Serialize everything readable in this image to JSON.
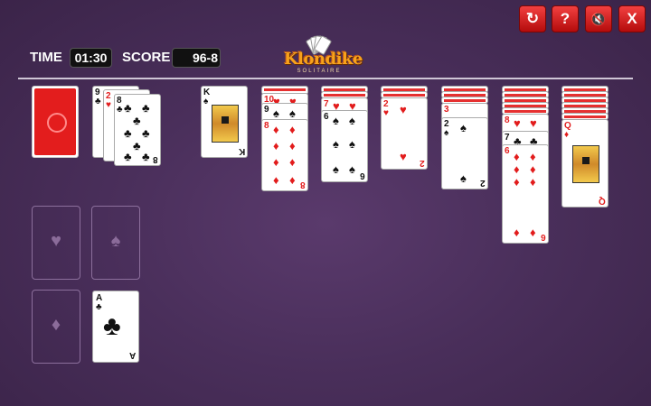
{
  "hud": {
    "time_label": "TIME",
    "time_value": "01:30",
    "score_label": "SCORE",
    "score_value": "96-8"
  },
  "logo": {
    "title": "Klondike",
    "subtitle": "SOLITAIRE"
  },
  "buttons": {
    "restart": "↻",
    "help": "?",
    "mute": "🔇",
    "close": "X"
  },
  "foundation": {
    "hearts": "♥",
    "spades": "♠",
    "diamonds": "♦",
    "clubs_card_rank": "A",
    "clubs_card_suit": "♣"
  },
  "waste": {
    "card1": {
      "rank": "9",
      "suit": "♣"
    },
    "card2": {
      "rank": "2",
      "suit": "♥"
    },
    "card3": {
      "rank": "8",
      "suit": "♣"
    }
  },
  "tableau": {
    "col1": {
      "rank": "K",
      "suit": "♠"
    },
    "col2": {
      "upper_rank": "10",
      "upper_suit": "♥",
      "mid_rank": "9",
      "mid_suit": "♠",
      "rank": "8",
      "suit": "♦"
    },
    "col3": {
      "upper_rank": "7",
      "upper_suit": "♥",
      "rank": "6",
      "suit": "♠"
    },
    "col4": {
      "rank": "2",
      "suit": "♥"
    },
    "col5": {
      "rank": "2",
      "suit": "♠"
    },
    "col6": {
      "upper_rank": "8",
      "upper_suit": "♥",
      "mid_rank": "7",
      "mid_suit": "♣",
      "rank": "6",
      "suit": "♦"
    },
    "col7": {
      "rank": "Q",
      "suit": "♦"
    }
  }
}
